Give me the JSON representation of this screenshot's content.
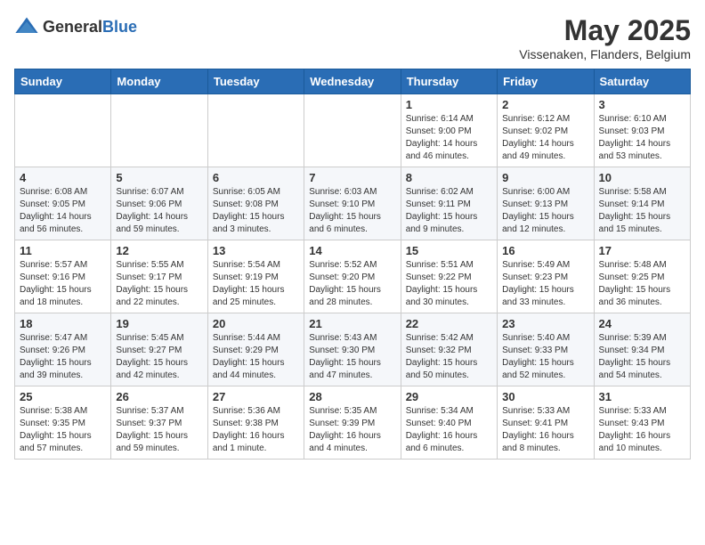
{
  "header": {
    "logo_general": "General",
    "logo_blue": "Blue",
    "month_title": "May 2025",
    "location": "Vissenaken, Flanders, Belgium"
  },
  "weekdays": [
    "Sunday",
    "Monday",
    "Tuesday",
    "Wednesday",
    "Thursday",
    "Friday",
    "Saturday"
  ],
  "weeks": [
    [
      {
        "day": "",
        "info": ""
      },
      {
        "day": "",
        "info": ""
      },
      {
        "day": "",
        "info": ""
      },
      {
        "day": "",
        "info": ""
      },
      {
        "day": "1",
        "info": "Sunrise: 6:14 AM\nSunset: 9:00 PM\nDaylight: 14 hours\nand 46 minutes."
      },
      {
        "day": "2",
        "info": "Sunrise: 6:12 AM\nSunset: 9:02 PM\nDaylight: 14 hours\nand 49 minutes."
      },
      {
        "day": "3",
        "info": "Sunrise: 6:10 AM\nSunset: 9:03 PM\nDaylight: 14 hours\nand 53 minutes."
      }
    ],
    [
      {
        "day": "4",
        "info": "Sunrise: 6:08 AM\nSunset: 9:05 PM\nDaylight: 14 hours\nand 56 minutes."
      },
      {
        "day": "5",
        "info": "Sunrise: 6:07 AM\nSunset: 9:06 PM\nDaylight: 14 hours\nand 59 minutes."
      },
      {
        "day": "6",
        "info": "Sunrise: 6:05 AM\nSunset: 9:08 PM\nDaylight: 15 hours\nand 3 minutes."
      },
      {
        "day": "7",
        "info": "Sunrise: 6:03 AM\nSunset: 9:10 PM\nDaylight: 15 hours\nand 6 minutes."
      },
      {
        "day": "8",
        "info": "Sunrise: 6:02 AM\nSunset: 9:11 PM\nDaylight: 15 hours\nand 9 minutes."
      },
      {
        "day": "9",
        "info": "Sunrise: 6:00 AM\nSunset: 9:13 PM\nDaylight: 15 hours\nand 12 minutes."
      },
      {
        "day": "10",
        "info": "Sunrise: 5:58 AM\nSunset: 9:14 PM\nDaylight: 15 hours\nand 15 minutes."
      }
    ],
    [
      {
        "day": "11",
        "info": "Sunrise: 5:57 AM\nSunset: 9:16 PM\nDaylight: 15 hours\nand 18 minutes."
      },
      {
        "day": "12",
        "info": "Sunrise: 5:55 AM\nSunset: 9:17 PM\nDaylight: 15 hours\nand 22 minutes."
      },
      {
        "day": "13",
        "info": "Sunrise: 5:54 AM\nSunset: 9:19 PM\nDaylight: 15 hours\nand 25 minutes."
      },
      {
        "day": "14",
        "info": "Sunrise: 5:52 AM\nSunset: 9:20 PM\nDaylight: 15 hours\nand 28 minutes."
      },
      {
        "day": "15",
        "info": "Sunrise: 5:51 AM\nSunset: 9:22 PM\nDaylight: 15 hours\nand 30 minutes."
      },
      {
        "day": "16",
        "info": "Sunrise: 5:49 AM\nSunset: 9:23 PM\nDaylight: 15 hours\nand 33 minutes."
      },
      {
        "day": "17",
        "info": "Sunrise: 5:48 AM\nSunset: 9:25 PM\nDaylight: 15 hours\nand 36 minutes."
      }
    ],
    [
      {
        "day": "18",
        "info": "Sunrise: 5:47 AM\nSunset: 9:26 PM\nDaylight: 15 hours\nand 39 minutes."
      },
      {
        "day": "19",
        "info": "Sunrise: 5:45 AM\nSunset: 9:27 PM\nDaylight: 15 hours\nand 42 minutes."
      },
      {
        "day": "20",
        "info": "Sunrise: 5:44 AM\nSunset: 9:29 PM\nDaylight: 15 hours\nand 44 minutes."
      },
      {
        "day": "21",
        "info": "Sunrise: 5:43 AM\nSunset: 9:30 PM\nDaylight: 15 hours\nand 47 minutes."
      },
      {
        "day": "22",
        "info": "Sunrise: 5:42 AM\nSunset: 9:32 PM\nDaylight: 15 hours\nand 50 minutes."
      },
      {
        "day": "23",
        "info": "Sunrise: 5:40 AM\nSunset: 9:33 PM\nDaylight: 15 hours\nand 52 minutes."
      },
      {
        "day": "24",
        "info": "Sunrise: 5:39 AM\nSunset: 9:34 PM\nDaylight: 15 hours\nand 54 minutes."
      }
    ],
    [
      {
        "day": "25",
        "info": "Sunrise: 5:38 AM\nSunset: 9:35 PM\nDaylight: 15 hours\nand 57 minutes."
      },
      {
        "day": "26",
        "info": "Sunrise: 5:37 AM\nSunset: 9:37 PM\nDaylight: 15 hours\nand 59 minutes."
      },
      {
        "day": "27",
        "info": "Sunrise: 5:36 AM\nSunset: 9:38 PM\nDaylight: 16 hours\nand 1 minute."
      },
      {
        "day": "28",
        "info": "Sunrise: 5:35 AM\nSunset: 9:39 PM\nDaylight: 16 hours\nand 4 minutes."
      },
      {
        "day": "29",
        "info": "Sunrise: 5:34 AM\nSunset: 9:40 PM\nDaylight: 16 hours\nand 6 minutes."
      },
      {
        "day": "30",
        "info": "Sunrise: 5:33 AM\nSunset: 9:41 PM\nDaylight: 16 hours\nand 8 minutes."
      },
      {
        "day": "31",
        "info": "Sunrise: 5:33 AM\nSunset: 9:43 PM\nDaylight: 16 hours\nand 10 minutes."
      }
    ]
  ]
}
